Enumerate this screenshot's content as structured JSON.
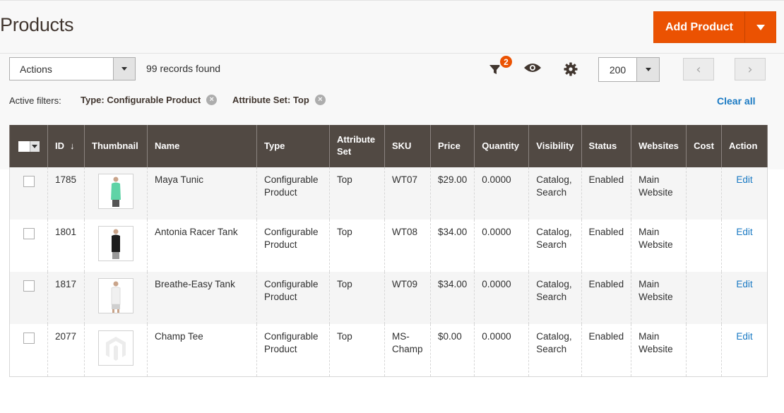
{
  "header": {
    "title": "Products",
    "add_button_label": "Add Product",
    "colors": {
      "accent": "#eb5202",
      "header_bg": "#514943",
      "link": "#1979c3"
    }
  },
  "toolbar": {
    "actions_label": "Actions",
    "records_found": "99 records found",
    "filter_icon": "filter-icon",
    "filter_count": "2",
    "columns_icon": "eye-icon",
    "settings_icon": "gear-icon",
    "per_page": "200",
    "prev_label": "‹",
    "next_label": "›"
  },
  "filters": {
    "label": "Active filters:",
    "items": [
      {
        "label": "Type: Configurable Product"
      },
      {
        "label": "Attribute Set: Top"
      }
    ],
    "clear_all": "Clear all"
  },
  "table": {
    "columns": [
      "",
      "ID",
      "Thumbnail",
      "Name",
      "Type",
      "Attribute Set",
      "SKU",
      "Price",
      "Quantity",
      "Visibility",
      "Status",
      "Websites",
      "Cost",
      "Action"
    ],
    "sort_indicator": "↓",
    "rows": [
      {
        "id": "1785",
        "thumbnail": "green-tank",
        "name": "Maya Tunic",
        "type": "Configurable Product",
        "attribute_set": "Top",
        "sku": "WT07",
        "price": "$29.00",
        "quantity": "0.0000",
        "visibility": "Catalog, Search",
        "status": "Enabled",
        "websites": "Main Website",
        "cost": "",
        "action": "Edit"
      },
      {
        "id": "1801",
        "thumbnail": "black-tank",
        "name": "Antonia Racer Tank",
        "type": "Configurable Product",
        "attribute_set": "Top",
        "sku": "WT08",
        "price": "$34.00",
        "quantity": "0.0000",
        "visibility": "Catalog, Search",
        "status": "Enabled",
        "websites": "Main Website",
        "cost": "",
        "action": "Edit"
      },
      {
        "id": "1817",
        "thumbnail": "white-tank",
        "name": "Breathe-Easy Tank",
        "type": "Configurable Product",
        "attribute_set": "Top",
        "sku": "WT09",
        "price": "$34.00",
        "quantity": "0.0000",
        "visibility": "Catalog, Search",
        "status": "Enabled",
        "websites": "Main Website",
        "cost": "",
        "action": "Edit"
      },
      {
        "id": "2077",
        "thumbnail": "placeholder",
        "name": "Champ Tee",
        "type": "Configurable Product",
        "attribute_set": "Top",
        "sku": "MS-Champ",
        "price": "$0.00",
        "quantity": "0.0000",
        "visibility": "Catalog, Search",
        "status": "Enabled",
        "websites": "Main Website",
        "cost": "",
        "action": "Edit"
      }
    ]
  }
}
